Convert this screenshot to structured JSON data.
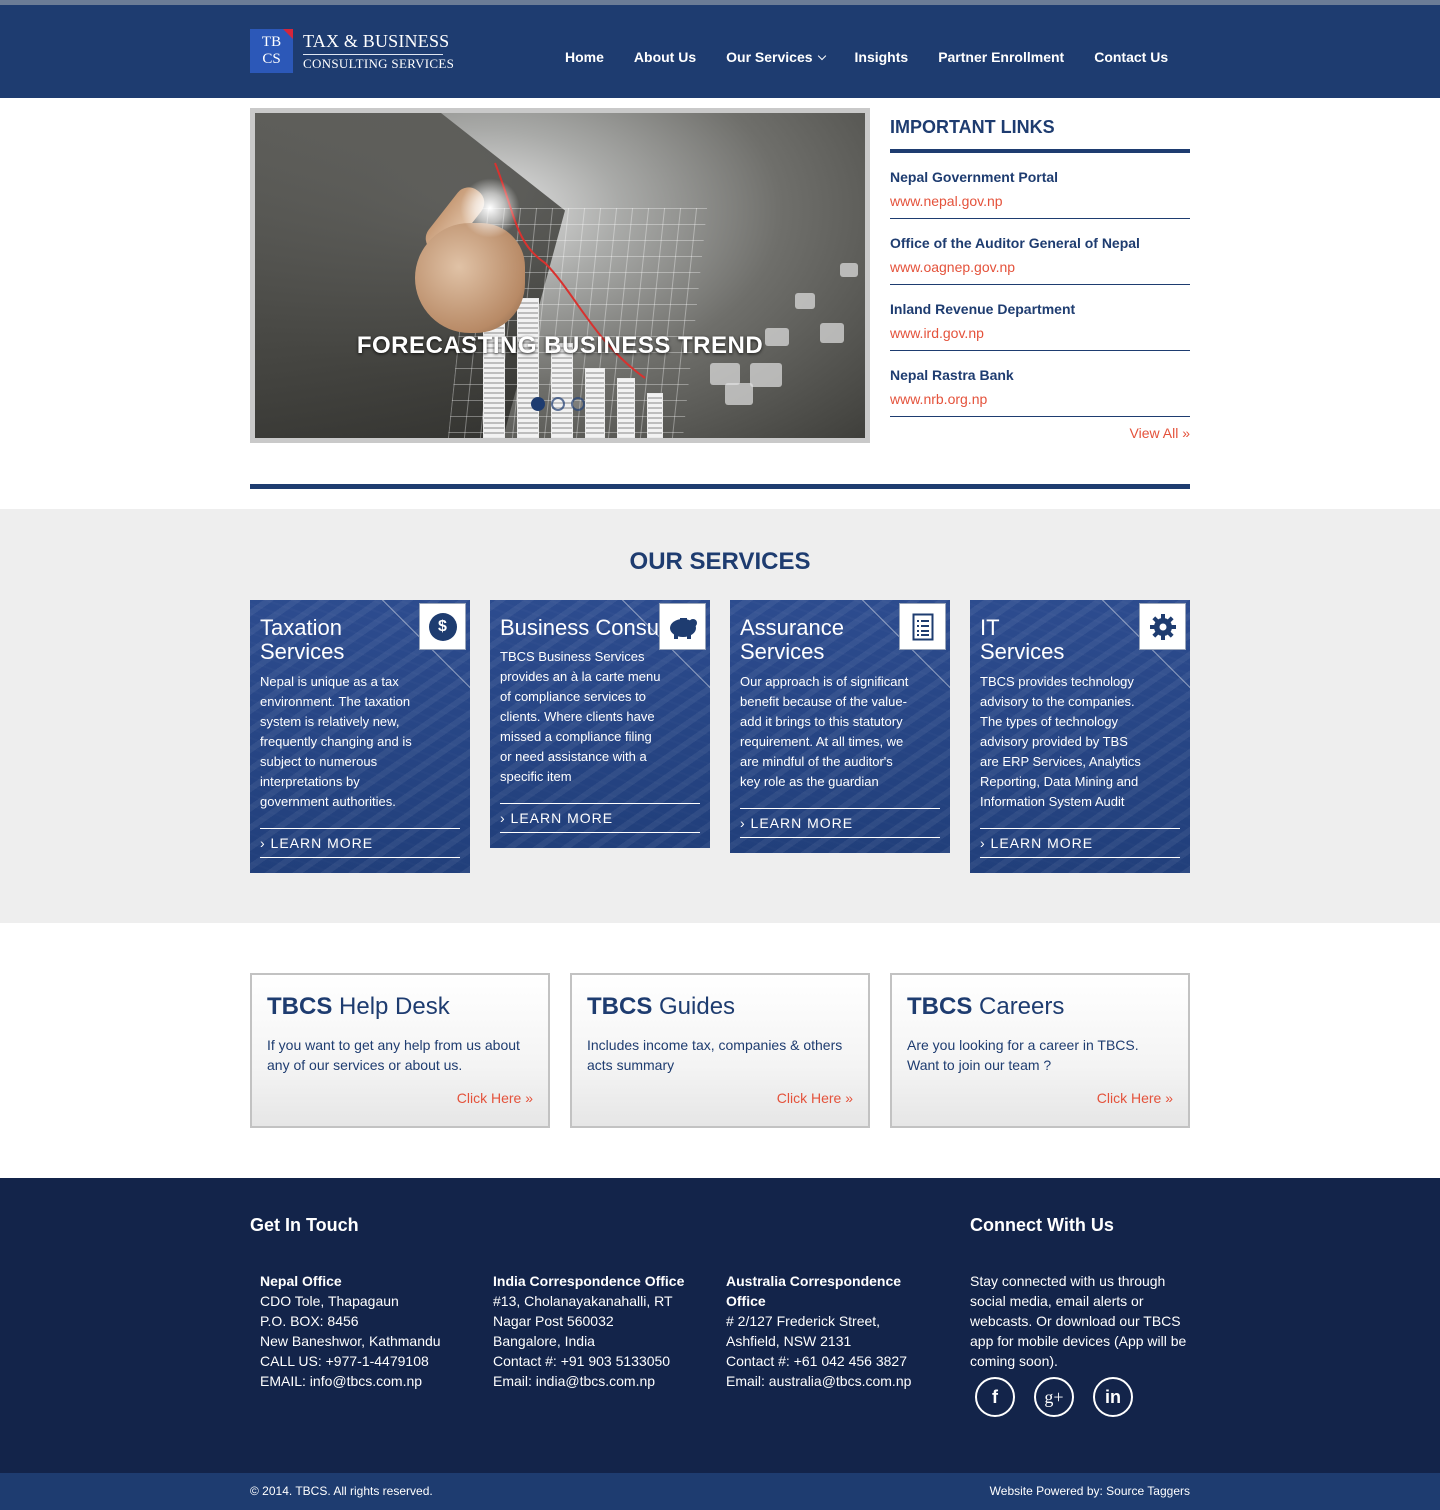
{
  "header": {
    "logo_badge_line1": "TB",
    "logo_badge_line2": "CS",
    "logo_title": "TAX & BUSINESS",
    "logo_subtitle": "CONSULTING SERVICES",
    "nav": [
      "Home",
      "About Us",
      "Our Services",
      "Insights",
      "Partner Enrollment",
      "Contact Us"
    ]
  },
  "slider": {
    "caption": "FORECASTING BUSINESS TREND",
    "slide_count": 3,
    "active_slide": 1
  },
  "important_links": {
    "title": "IMPORTANT LINKS",
    "items": [
      {
        "title": "Nepal Government Portal",
        "url": "www.nepal.gov.np"
      },
      {
        "title": "Office of the Auditor General of Nepal",
        "url": "www.oagnep.gov.np"
      },
      {
        "title": "Inland Revenue Department",
        "url": "www.ird.gov.np"
      },
      {
        "title": "Nepal Rastra Bank",
        "url": "www.nrb.org.np"
      }
    ],
    "view_all": "View All »"
  },
  "services": {
    "title": "OUR SERVICES",
    "learn_more": "› LEARN MORE",
    "items": [
      {
        "title_line1": "Taxation",
        "title_line2": "Services",
        "icon": "dollar-icon",
        "text": "Nepal is unique as a tax environment. The taxation system is relatively new, frequently changing and is subject to numerous interpretations by government authorities."
      },
      {
        "title_line1": "Business Consulting",
        "title_line2": "",
        "icon": "piggy-bank-icon",
        "text": "TBCS Business Services provides an à la carte menu of compliance services to clients. Where clients have missed a compliance filing or need assistance with a specific item"
      },
      {
        "title_line1": "Assurance",
        "title_line2": "Services",
        "icon": "document-list-icon",
        "text": "Our approach is of significant benefit because of the value-add it brings to this statutory requirement. At all times, we are mindful of the auditor's key role as the guardian"
      },
      {
        "title_line1": "IT",
        "title_line2": "Services",
        "icon": "gear-icon",
        "text": "TBCS provides technology advisory to the companies. The types of technology advisory provided by TBS are ERP Services, Analytics Reporting, Data Mining and Information System Audit"
      }
    ]
  },
  "info_boxes": [
    {
      "brand": "TBCS",
      "title": " Help Desk",
      "text": "If you want to get any help from us about any of our services or about us.",
      "link": "Click Here »"
    },
    {
      "brand": "TBCS",
      "title": " Guides",
      "text": "Includes income tax, companies & others acts summary",
      "link": "Click Here »"
    },
    {
      "brand": "TBCS",
      "title": " Careers",
      "text": "Are you looking for a career in TBCS. Want to join our team ?",
      "link": "Click Here »"
    }
  ],
  "footer": {
    "get_in_touch": "Get In Touch",
    "connect_title": "Connect With Us",
    "connect_text": "Stay connected with us through social media, email alerts or webcasts. Or download our TBCS app for mobile devices (App will be coming soon).",
    "offices": [
      {
        "name": "Nepal Office",
        "lines": [
          "CDO Tole, Thapagaun",
          "P.O. BOX: 8456",
          "New Baneshwor, Kathmandu",
          "CALL US: +977-1-4479108",
          "EMAIL: info@tbcs.com.np"
        ]
      },
      {
        "name": "India Correspondence Office",
        "lines": [
          "#13, Cholanayakanahalli, RT",
          "Nagar Post 560032",
          "Bangalore, India",
          "Contact #: +91 903 5133050",
          "Email: india@tbcs.com.np"
        ]
      },
      {
        "name": "Australia Correspondence Office",
        "lines": [
          "# 2/127 Frederick Street,",
          "Ashfield, NSW 2131",
          "Contact #: +61 042 456 3827",
          "Email: australia@tbcs.com.np"
        ]
      }
    ],
    "social": [
      {
        "icon": "facebook-icon",
        "glyph": "f"
      },
      {
        "icon": "google-plus-icon",
        "glyph": "g+"
      },
      {
        "icon": "linkedin-icon",
        "glyph": "in"
      }
    ]
  },
  "bottom_bar": {
    "copyright": "© 2014. TBCS. All rights reserved.",
    "powered": "Website Powered by: Source Taggers"
  },
  "colors": {
    "primary": "#1e3c70",
    "accent": "#e4523b",
    "footer": "#13244a"
  }
}
